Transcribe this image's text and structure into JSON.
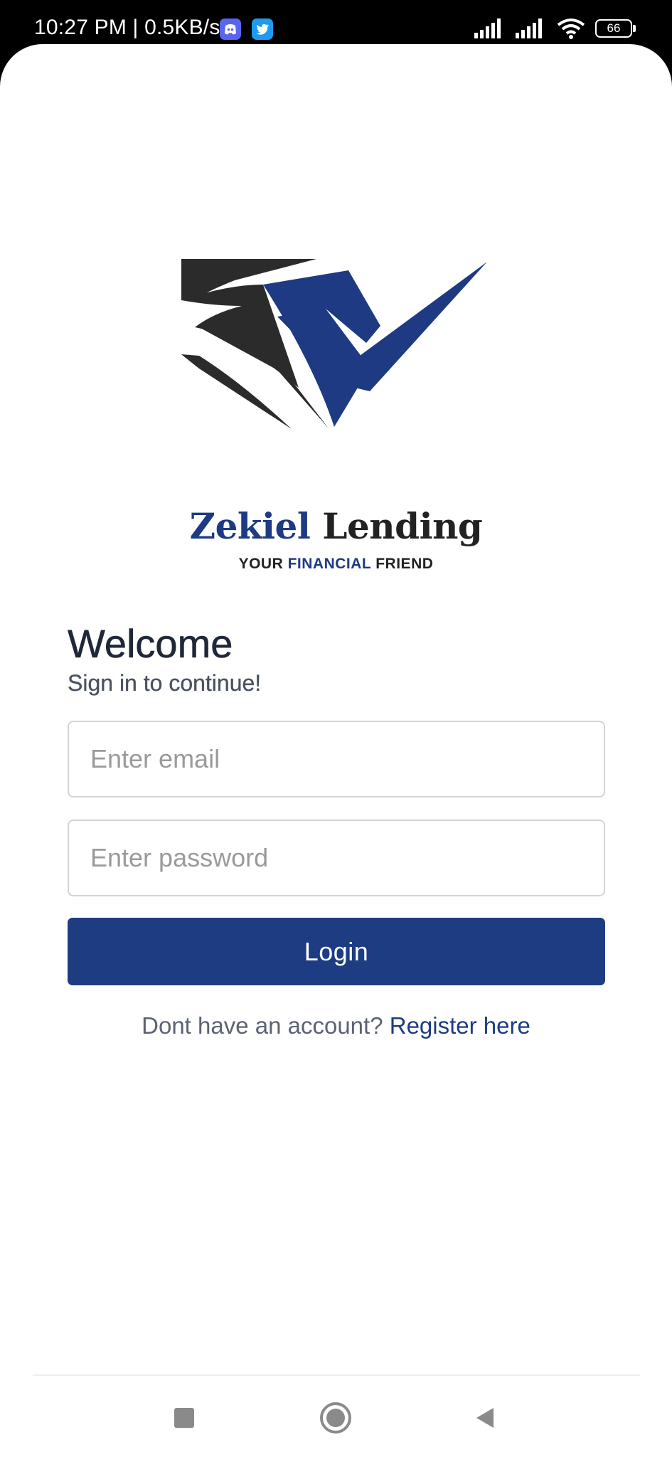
{
  "status_bar": {
    "time": "10:27 PM | 0.5KB/s",
    "apps": [
      "discord-icon",
      "twitter-icon"
    ],
    "battery_level": "66"
  },
  "brand": {
    "name_part1": "Zekiel",
    "name_part2": "Lending",
    "tagline_part1": "YOUR",
    "tagline_part2": "FINANCIAL",
    "tagline_part3": "FRIEND",
    "colors": {
      "primary": "#1e3c82",
      "dark": "#222222"
    }
  },
  "login": {
    "title": "Welcome",
    "subtitle": "Sign in to continue!",
    "email_placeholder": "Enter email",
    "password_placeholder": "Enter password",
    "button_label": "Login",
    "register_prompt": "Dont have an account?",
    "register_link": "Register here"
  },
  "nav_bar": {
    "buttons": [
      "recents-square-icon",
      "home-circle-icon",
      "back-triangle-icon"
    ]
  }
}
